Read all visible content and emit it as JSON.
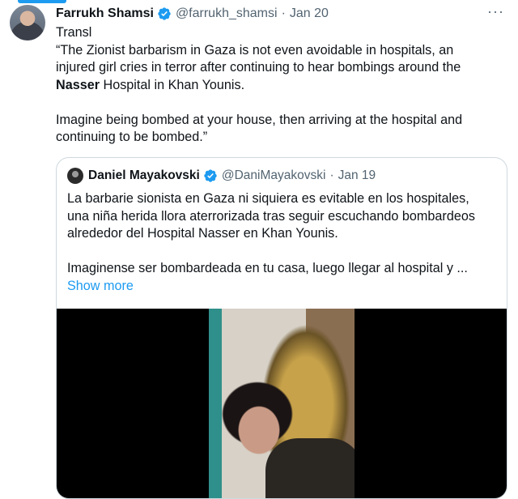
{
  "tweet": {
    "author_name": "Farrukh Shamsi",
    "handle": "@farrukh_shamsi",
    "separator": "·",
    "date": "Jan 20",
    "more_glyph": "···",
    "text_lines": [
      "Transl",
      "“The Zionist barbarism in Gaza is not even avoidable in hospitals, an",
      "injured girl cries in terror after continuing to hear bombings around the"
    ],
    "text_bold_word": "Nasser",
    "text_line_after_bold": " Hospital in Khan Younis.",
    "text_paragraph2_lines": [
      "Imagine being bombed at your house, then arriving at the hospital and",
      "continuing to be bombed.”"
    ]
  },
  "quote": {
    "author_name": "Daniel Mayakovski",
    "handle": "@DaniMayakovski",
    "separator": "·",
    "date": "Jan 19",
    "text_lines": [
      "La barbarie sionista en Gaza ni siquiera es evitable en los hospitales,",
      "una niña herida llora aterrorizada tras seguir escuchando bombardeos",
      "alrededor del Hospital Nasser en Khan Younis."
    ],
    "text_paragraph2": "Imaginense ser bombardeada en tu casa, luego llegar al hospital y ...",
    "show_more": "Show more"
  },
  "colors": {
    "accent": "#1d9bf0",
    "secondary_text": "#536471",
    "border": "#cfd9de"
  },
  "icons": {
    "verified": "verified-badge-icon",
    "more": "more-options-icon"
  }
}
